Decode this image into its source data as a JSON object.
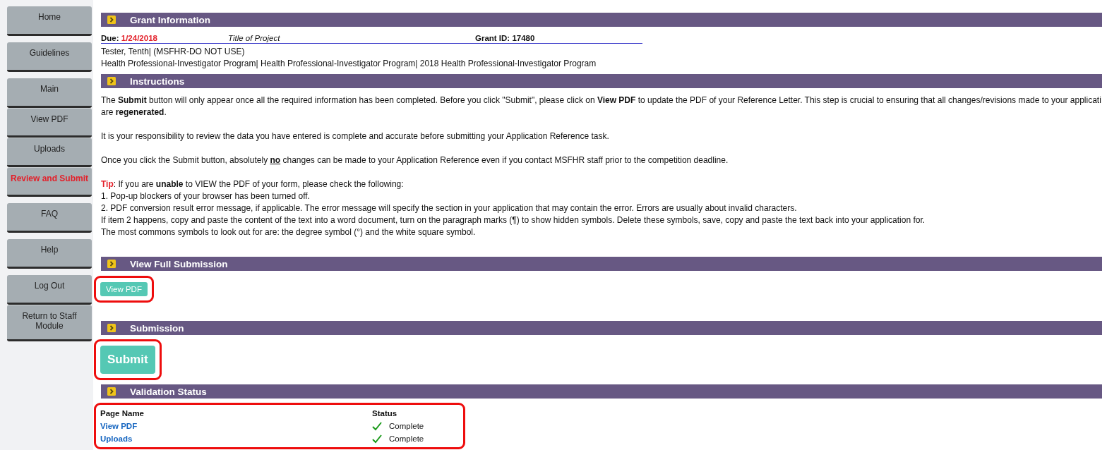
{
  "sidebar": {
    "groups": [
      [
        {
          "label": "Home",
          "selected": false
        }
      ],
      [
        {
          "label": "Guidelines",
          "selected": false
        }
      ],
      [
        {
          "label": "Main",
          "selected": false
        },
        {
          "label": "View PDF",
          "selected": false
        },
        {
          "label": "Uploads",
          "selected": false
        },
        {
          "label": "Review and Submit",
          "selected": true
        }
      ],
      [
        {
          "label": "FAQ",
          "selected": false
        }
      ],
      [
        {
          "label": "Help",
          "selected": false
        }
      ],
      [
        {
          "label": "Log Out",
          "selected": false
        },
        {
          "label": "Return to Staff Module",
          "selected": false
        }
      ]
    ]
  },
  "grant_information": {
    "title": "Grant Information",
    "due_label": "Due:",
    "due_date": "1/24/2018",
    "project_title": "Title of Project",
    "grant_id_label": "Grant ID:",
    "grant_id": "17480",
    "lines": [
      "Tester, Tenth| (MSFHR-DO NOT USE)",
      "Health Professional-Investigator Program| Health Professional-Investigator Program| 2018 Health Professional-Investigator Program"
    ]
  },
  "instructions": {
    "title": "Instructions",
    "paragraphs": [
      [
        [
          {
            "text": "The "
          },
          {
            "text": "Submit",
            "kind": "bold"
          },
          {
            "text": " button will only appear once all the required information has been completed. Before you click \"Submit\", please click on "
          },
          {
            "text": "View PDF",
            "kind": "bold"
          },
          {
            "text": " to update the PDF of your Reference Letter. This step is crucial to ensuring that all changes/revisions made to your applicati"
          }
        ],
        [
          {
            "text": "are "
          },
          {
            "text": "regenerated",
            "kind": "bold"
          },
          {
            "text": "."
          }
        ]
      ],
      [
        [
          {
            "text": "It is your responsibility to review the data you have entered is complete and accurate before submitting your Application Reference task."
          }
        ]
      ],
      [
        [
          {
            "text": "Once you click the Submit button, absolutely "
          },
          {
            "text": "no",
            "kind": "emphasis"
          },
          {
            "text": " changes can be made to your Application Reference even if you contact MSFHR staff prior to the competition deadline."
          }
        ]
      ],
      [
        [
          {
            "text": "Tip",
            "kind": "warning"
          },
          {
            "text": ": If you are "
          },
          {
            "text": "unable",
            "kind": "bold"
          },
          {
            "text": " to VIEW the PDF of your form, please check the following:"
          }
        ],
        [
          {
            "text": "1. Pop-up blockers of your browser has been turned off."
          }
        ],
        [
          {
            "text": "2. PDF conversion result error message, if applicable. The error message will specify the section in your application that may contain the error. Errors are usually about invalid characters."
          }
        ],
        [
          {
            "text": "If item 2 happens, copy and paste the content of the text into a word document, turn on the paragraph marks (¶) to show hidden symbols. Delete these symbols, save, copy and paste the text back into your application for."
          }
        ],
        [
          {
            "text": "The most commons symbols to look out for are: the degree symbol (°) and the white square symbol."
          }
        ]
      ]
    ]
  },
  "view_full_submission": {
    "title": "View Full Submission",
    "button": "View PDF",
    "highlighted": true
  },
  "submission": {
    "title": "Submission",
    "button": "Submit",
    "highlighted": true
  },
  "validation_status": {
    "title": "Validation Status",
    "highlighted": true,
    "columns": [
      "Page Name",
      "Status"
    ],
    "rows": [
      {
        "page": "View PDF",
        "complete": true,
        "status": "Complete"
      },
      {
        "page": "Uploads",
        "complete": true,
        "status": "Complete"
      }
    ]
  }
}
